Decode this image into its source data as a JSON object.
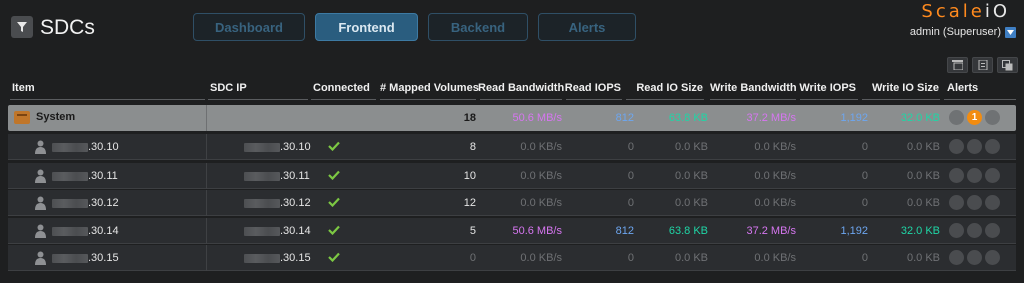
{
  "header": {
    "title": "SDCs",
    "brand_main": "Scale",
    "brand_suffix": "iO",
    "user": "admin (Superuser)"
  },
  "tabs": [
    {
      "label": "Dashboard"
    },
    {
      "label": "Frontend",
      "active": true
    },
    {
      "label": "Backend"
    },
    {
      "label": "Alerts"
    }
  ],
  "columns": {
    "item": "Item",
    "sdc_ip": "SDC IP",
    "connected": "Connected",
    "mapped": "# Mapped Volumes",
    "read_bw": "Read Bandwidth",
    "read_iops": "Read IOPS",
    "read_io": "Read IO Size",
    "write_bw": "Write Bandwidth",
    "write_iops": "Write IOPS",
    "write_io": "Write IO Size",
    "alerts": "Alerts"
  },
  "system": {
    "label": "System",
    "mapped": "18",
    "read_bw": "50.6 MB/s",
    "read_iops": "812",
    "read_io": "63.8 KB",
    "write_bw": "37.2 MB/s",
    "write_iops": "1,192",
    "write_io": "32.0 KB",
    "alert_count": "1"
  },
  "rows": [
    {
      "item": ".30.10",
      "ip": ".30.10",
      "mapped": "8",
      "read_bw": "0.0 KB/s",
      "read_iops": "0",
      "read_io": "0.0 KB",
      "write_bw": "0.0 KB/s",
      "write_iops": "0",
      "write_io": "0.0 KB"
    },
    {
      "item": ".30.11",
      "ip": ".30.11",
      "mapped": "10",
      "read_bw": "0.0 KB/s",
      "read_iops": "0",
      "read_io": "0.0 KB",
      "write_bw": "0.0 KB/s",
      "write_iops": "0",
      "write_io": "0.0 KB"
    },
    {
      "item": ".30.12",
      "ip": ".30.12",
      "mapped": "12",
      "read_bw": "0.0 KB/s",
      "read_iops": "0",
      "read_io": "0.0 KB",
      "write_bw": "0.0 KB/s",
      "write_iops": "0",
      "write_io": "0.0 KB"
    },
    {
      "item": ".30.14",
      "ip": ".30.14",
      "mapped": "5",
      "read_bw": "50.6 MB/s",
      "read_iops": "812",
      "read_io": "63.8 KB",
      "write_bw": "37.2 MB/s",
      "write_iops": "1,192",
      "write_io": "32.0 KB"
    },
    {
      "item": ".30.15",
      "ip": ".30.15",
      "mapped": "0",
      "read_bw": "0.0 KB/s",
      "read_iops": "0",
      "read_io": "0.0 KB",
      "write_bw": "0.0 KB/s",
      "write_iops": "0",
      "write_io": "0.0 KB"
    }
  ],
  "colors": {
    "read_bandwidth": "#d676f0",
    "iops": "#6da6f0",
    "io_size": "#1fd6a6",
    "alert_badge": "#f28c10",
    "active_tab": "#2a5d7f",
    "brand": "#ff8a1e"
  },
  "icons": {
    "filter": "filter-icon",
    "user_dropdown": "chevron-down-icon",
    "system": "system-icon",
    "sdc": "person-icon",
    "connected": "check-icon"
  }
}
